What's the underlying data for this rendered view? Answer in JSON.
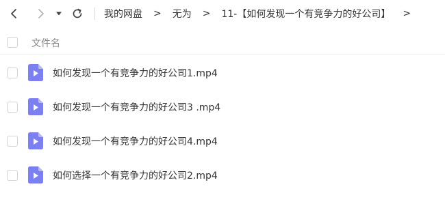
{
  "nav": {
    "back_icon": "chevron-left-icon",
    "forward_icon": "chevron-right-icon",
    "dropdown_icon": "caret-down-icon",
    "refresh_icon": "refresh-icon"
  },
  "breadcrumb": {
    "items": [
      "我的网盘",
      "无为",
      "11-【如何发现一个有竞争力的好公司】"
    ],
    "separator": ">"
  },
  "header": {
    "column_label": "文件名"
  },
  "files": [
    {
      "name": "如何发现一个有竞争力的好公司1.mp4",
      "icon": "video-file-icon"
    },
    {
      "name": "如何发现一个有竞争力的好公司3 .mp4",
      "icon": "video-file-icon"
    },
    {
      "name": "如何发现一个有竞争力的好公司4.mp4",
      "icon": "video-file-icon"
    },
    {
      "name": "如何选择一个有竞争力的好公司2.mp4",
      "icon": "video-file-icon"
    }
  ],
  "colors": {
    "file_icon": "#7b7ff0",
    "file_icon_fold": "#b7b9f7",
    "text": "#333333",
    "muted_text": "#888888"
  }
}
